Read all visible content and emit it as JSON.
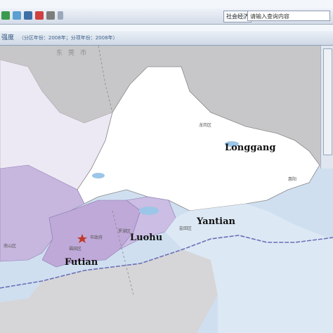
{
  "toolbar": {
    "icons": [
      "back-icon",
      "map-icon",
      "disk-icon",
      "layers-icon",
      "print-icon"
    ],
    "tab_label": "社会经济",
    "search_value": "请输入查询内容"
  },
  "header": {
    "title": "强度",
    "note": "（分区年份：2008年；分项年份：2008年）"
  },
  "map": {
    "districts": {
      "longgang": "Longgang",
      "yantian": "Yantian",
      "luohu": "Luohu",
      "futian": "Futian"
    },
    "place_labels": {
      "dongguan": "东莞市",
      "longgang_cn": "龙岗区",
      "yantian_cn": "盐田区",
      "luohu_cn": "罗湖区",
      "futian_cn": "福田区",
      "nanshan_cn": "南山区",
      "city_gov": "市政府",
      "huiyang": "惠阳"
    },
    "colors": {
      "sea": "#cfdff0",
      "land_outside": "#c9c9c9",
      "nanshan_baoan": "#ece8f4",
      "futian_luohu": "#c7b7df",
      "longgang": "#ffffff",
      "border": "#6b6fb6"
    }
  }
}
